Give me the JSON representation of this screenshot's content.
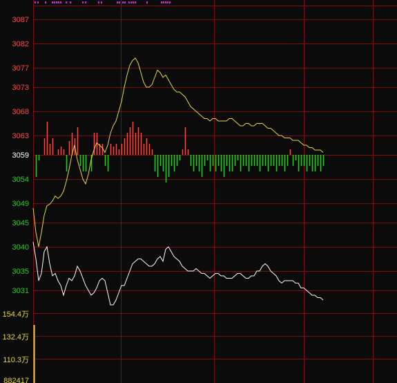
{
  "colors": {
    "background": "#0b0b0b",
    "grid": "#7a1010",
    "up": "#f05050",
    "down": "#2fc82f",
    "price_line": "#ffffff",
    "avg_line": "#e8d83a",
    "vol_tick": "#e8d83a",
    "top_markers": "#d020d0"
  },
  "chart_data": [
    {
      "type": "line",
      "title": "",
      "xlabel": "",
      "ylabel": "",
      "ylim": [
        3029,
        3089
      ],
      "grid": true,
      "y_ticks": [
        {
          "label": "3087",
          "value": 3087,
          "color": "#f05050"
        },
        {
          "label": "3082",
          "value": 3082,
          "color": "#f05050"
        },
        {
          "label": "3077",
          "value": 3077,
          "color": "#f05050"
        },
        {
          "label": "3073",
          "value": 3073,
          "color": "#f05050"
        },
        {
          "label": "3068",
          "value": 3068,
          "color": "#f05050"
        },
        {
          "label": "3063",
          "value": 3063,
          "color": "#f05050"
        },
        {
          "label": "3059",
          "value": 3059,
          "color": "#ffffff"
        },
        {
          "label": "3054",
          "value": 3054,
          "color": "#2fc82f"
        },
        {
          "label": "3049",
          "value": 3049,
          "color": "#2fc82f"
        },
        {
          "label": "3045",
          "value": 3045,
          "color": "#2fc82f"
        },
        {
          "label": "3040",
          "value": 3040,
          "color": "#2fc82f"
        },
        {
          "label": "3035",
          "value": 3035,
          "color": "#2fc82f"
        },
        {
          "label": "3031",
          "value": 3031,
          "color": "#2fc82f"
        }
      ],
      "baseline": 3059,
      "series": [
        {
          "role": "price",
          "color": "#ffffff",
          "x": [
            0,
            4,
            8,
            12,
            16,
            20,
            24,
            28,
            32,
            36,
            40,
            44,
            48,
            52,
            56,
            60,
            64,
            68,
            72,
            76,
            80,
            84,
            88,
            92,
            96,
            100,
            104,
            108,
            112,
            116,
            120,
            124,
            128,
            132,
            136,
            140,
            144,
            148,
            152,
            156,
            160,
            164,
            168,
            172,
            176,
            180,
            184,
            188,
            192,
            196,
            200,
            204,
            208,
            212,
            216,
            220,
            224,
            228,
            232,
            236,
            240,
            244,
            248,
            252,
            256,
            260,
            264,
            268,
            272,
            276,
            280,
            284,
            288,
            292,
            296,
            300,
            304,
            308,
            312,
            316,
            320,
            324,
            328,
            332,
            336,
            340,
            344,
            348,
            352,
            356,
            360,
            364,
            368,
            372,
            376,
            380,
            384,
            388,
            392,
            396,
            400,
            404,
            408,
            412,
            416,
            420
          ],
          "values": [
            3041.0,
            3037.5,
            3033.0,
            3034.5,
            3039.0,
            3040.0,
            3036.5,
            3034.0,
            3034.5,
            3033.0,
            3032.0,
            3030.0,
            3032.0,
            3033.5,
            3033.0,
            3034.0,
            3036.0,
            3035.0,
            3033.5,
            3032.0,
            3031.0,
            3030.0,
            3030.5,
            3031.5,
            3033.0,
            3033.5,
            3033.0,
            3030.5,
            3028.0,
            3028.0,
            3029.0,
            3030.5,
            3032.0,
            3032.0,
            3033.5,
            3035.0,
            3036.5,
            3037.0,
            3037.5,
            3037.5,
            3037.0,
            3036.5,
            3036.0,
            3036.0,
            3036.5,
            3037.5,
            3038.0,
            3037.0,
            3039.5,
            3040.0,
            3039.0,
            3038.0,
            3037.5,
            3037.0,
            3036.0,
            3035.5,
            3035.0,
            3035.0,
            3035.0,
            3035.5,
            3035.0,
            3034.5,
            3034.5,
            3034.0,
            3033.5,
            3034.0,
            3034.5,
            3034.5,
            3034.0,
            3034.0,
            3033.5,
            3033.5,
            3033.5,
            3034.0,
            3034.5,
            3034.5,
            3034.0,
            3033.5,
            3033.5,
            3034.0,
            3034.0,
            3035.0,
            3035.0,
            3036.0,
            3036.5,
            3036.0,
            3035.0,
            3034.5,
            3034.0,
            3033.0,
            3032.5,
            3033.0,
            3033.0,
            3033.0,
            3033.0,
            3032.5,
            3032.5,
            3031.5,
            3031.5,
            3031.0,
            3030.5,
            3030.0,
            3030.0,
            3029.5,
            3029.5,
            3029.0
          ]
        },
        {
          "role": "average",
          "color": "#e8d83a",
          "x": [
            0,
            4,
            8,
            12,
            16,
            20,
            24,
            28,
            32,
            36,
            40,
            44,
            48,
            52,
            56,
            60,
            64,
            68,
            72,
            76,
            80,
            84,
            88,
            92,
            96,
            100,
            104,
            108,
            112,
            116,
            120,
            124,
            128,
            132,
            136,
            140,
            144,
            148,
            152,
            156,
            160,
            164,
            168,
            172,
            176,
            180,
            184,
            188,
            192,
            196,
            200,
            204,
            208,
            212,
            216,
            220,
            224,
            228,
            232,
            236,
            240,
            244,
            248,
            252,
            256,
            260,
            264,
            268,
            272,
            276,
            280,
            284,
            288,
            292,
            296,
            300,
            304,
            308,
            312,
            316,
            320,
            324,
            328,
            332,
            336,
            340,
            344,
            348,
            352,
            356,
            360,
            364,
            368,
            372,
            376,
            380,
            384,
            388,
            392,
            396,
            400,
            404,
            408,
            412,
            416,
            420
          ],
          "values": [
            3048.0,
            3043.0,
            3040.0,
            3043.0,
            3046.5,
            3048.5,
            3048.8,
            3049.5,
            3050.5,
            3050.0,
            3050.5,
            3051.5,
            3053.5,
            3056.0,
            3059.0,
            3061.0,
            3058.0,
            3056.0,
            3054.0,
            3053.0,
            3055.0,
            3058.0,
            3060.0,
            3061.5,
            3061.0,
            3060.5,
            3059.5,
            3061.0,
            3063.5,
            3065.0,
            3066.0,
            3068.0,
            3070.0,
            3073.0,
            3075.5,
            3077.5,
            3078.5,
            3079.0,
            3078.0,
            3076.0,
            3074.0,
            3073.0,
            3073.0,
            3073.5,
            3075.0,
            3076.5,
            3076.0,
            3075.0,
            3075.5,
            3074.5,
            3073.5,
            3072.5,
            3072.0,
            3072.0,
            3071.5,
            3071.0,
            3070.0,
            3069.0,
            3068.5,
            3068.0,
            3067.5,
            3067.0,
            3066.5,
            3066.5,
            3066.0,
            3066.5,
            3066.5,
            3066.0,
            3066.0,
            3066.0,
            3066.0,
            3066.5,
            3066.5,
            3066.0,
            3065.5,
            3065.0,
            3065.0,
            3065.5,
            3065.5,
            3065.0,
            3065.0,
            3065.5,
            3065.5,
            3065.5,
            3065.0,
            3064.5,
            3064.5,
            3064.0,
            3063.5,
            3063.0,
            3063.0,
            3062.5,
            3062.5,
            3062.5,
            3062.0,
            3062.0,
            3062.0,
            3061.5,
            3061.0,
            3061.0,
            3060.5,
            3060.5,
            3060.0,
            3060.0,
            3060.0,
            3059.5
          ]
        }
      ],
      "bars": [
        {
          "x": 4,
          "value": -4
        },
        {
          "x": 8,
          "value": -1
        },
        {
          "x": 16,
          "value": 3
        },
        {
          "x": 20,
          "value": 6
        },
        {
          "x": 24,
          "value": 2
        },
        {
          "x": 28,
          "value": 3
        },
        {
          "x": 36,
          "value": 1
        },
        {
          "x": 40,
          "value": 1.5
        },
        {
          "x": 44,
          "value": 1
        },
        {
          "x": 48,
          "value": -3
        },
        {
          "x": 52,
          "value": 2.5
        },
        {
          "x": 56,
          "value": 4
        },
        {
          "x": 60,
          "value": 3
        },
        {
          "x": 64,
          "value": 5
        },
        {
          "x": 68,
          "value": -2
        },
        {
          "x": 72,
          "value": -3
        },
        {
          "x": 76,
          "value": -3
        },
        {
          "x": 84,
          "value": -3
        },
        {
          "x": 88,
          "value": 4
        },
        {
          "x": 92,
          "value": 4
        },
        {
          "x": 96,
          "value": 2
        },
        {
          "x": 100,
          "value": 2
        },
        {
          "x": 104,
          "value": -2
        },
        {
          "x": 108,
          "value": -3
        },
        {
          "x": 112,
          "value": 2
        },
        {
          "x": 116,
          "value": 1.5
        },
        {
          "x": 120,
          "value": 2
        },
        {
          "x": 124,
          "value": 1
        },
        {
          "x": 128,
          "value": 2
        },
        {
          "x": 132,
          "value": 3
        },
        {
          "x": 136,
          "value": 4
        },
        {
          "x": 140,
          "value": 5
        },
        {
          "x": 144,
          "value": 6
        },
        {
          "x": 148,
          "value": 4
        },
        {
          "x": 152,
          "value": 5
        },
        {
          "x": 156,
          "value": 4
        },
        {
          "x": 160,
          "value": 2
        },
        {
          "x": 164,
          "value": 3
        },
        {
          "x": 168,
          "value": 2
        },
        {
          "x": 172,
          "value": 1
        },
        {
          "x": 176,
          "value": -3
        },
        {
          "x": 180,
          "value": -4
        },
        {
          "x": 184,
          "value": -2
        },
        {
          "x": 188,
          "value": -3
        },
        {
          "x": 192,
          "value": -5
        },
        {
          "x": 196,
          "value": -4
        },
        {
          "x": 200,
          "value": -2
        },
        {
          "x": 204,
          "value": -3
        },
        {
          "x": 208,
          "value": -2
        },
        {
          "x": 212,
          "value": -1
        },
        {
          "x": 216,
          "value": 1
        },
        {
          "x": 220,
          "value": 5
        },
        {
          "x": 224,
          "value": 1
        },
        {
          "x": 228,
          "value": -2
        },
        {
          "x": 232,
          "value": -3
        },
        {
          "x": 236,
          "value": -2
        },
        {
          "x": 240,
          "value": -3
        },
        {
          "x": 244,
          "value": -4
        },
        {
          "x": 248,
          "value": -2
        },
        {
          "x": 252,
          "value": -1
        },
        {
          "x": 256,
          "value": -3
        },
        {
          "x": 260,
          "value": -2
        },
        {
          "x": 264,
          "value": -3
        },
        {
          "x": 268,
          "value": -2
        },
        {
          "x": 272,
          "value": -3
        },
        {
          "x": 276,
          "value": -4
        },
        {
          "x": 280,
          "value": -2
        },
        {
          "x": 284,
          "value": -3
        },
        {
          "x": 288,
          "value": -3
        },
        {
          "x": 292,
          "value": -2
        },
        {
          "x": 296,
          "value": -1
        },
        {
          "x": 300,
          "value": -3
        },
        {
          "x": 304,
          "value": -2
        },
        {
          "x": 308,
          "value": -2
        },
        {
          "x": 312,
          "value": -3
        },
        {
          "x": 316,
          "value": -2
        },
        {
          "x": 320,
          "value": -2
        },
        {
          "x": 324,
          "value": -2
        },
        {
          "x": 328,
          "value": -3
        },
        {
          "x": 332,
          "value": -2
        },
        {
          "x": 336,
          "value": -2
        },
        {
          "x": 340,
          "value": -3
        },
        {
          "x": 344,
          "value": -2
        },
        {
          "x": 348,
          "value": -2
        },
        {
          "x": 352,
          "value": -3
        },
        {
          "x": 356,
          "value": -2
        },
        {
          "x": 360,
          "value": -2
        },
        {
          "x": 364,
          "value": -3
        },
        {
          "x": 368,
          "value": -2
        },
        {
          "x": 372,
          "value": 1
        },
        {
          "x": 376,
          "value": -2
        },
        {
          "x": 380,
          "value": -1
        },
        {
          "x": 384,
          "value": -3
        },
        {
          "x": 388,
          "value": -2
        },
        {
          "x": 392,
          "value": -2
        },
        {
          "x": 396,
          "value": -3
        },
        {
          "x": 400,
          "value": -2
        },
        {
          "x": 404,
          "value": -3
        },
        {
          "x": 408,
          "value": -3
        },
        {
          "x": 412,
          "value": -2
        },
        {
          "x": 416,
          "value": -3
        },
        {
          "x": 420,
          "value": -2
        }
      ]
    },
    {
      "type": "bar",
      "title": "",
      "y_ticks": [
        {
          "label": "154.4万",
          "color": "#e8d83a"
        },
        {
          "label": "132.4万",
          "color": "#e8d83a"
        },
        {
          "label": "110.3万",
          "color": "#e8d83a"
        },
        {
          "label": "882417",
          "color": "#e8d83a"
        }
      ],
      "values": [
        1
      ]
    }
  ]
}
